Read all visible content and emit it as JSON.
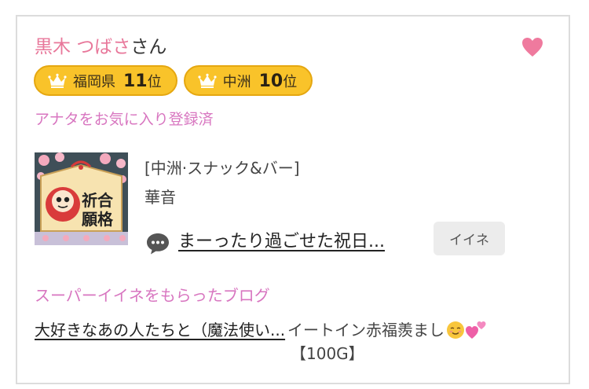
{
  "profile": {
    "name": "黒木 つばさ",
    "honorific": "さん",
    "favorite_icon": "heart-icon"
  },
  "rankings": [
    {
      "area": "福岡県",
      "rank": "11",
      "suffix": "位",
      "icon": "crown-icon"
    },
    {
      "area": "中洲",
      "rank": "10",
      "suffix": "位",
      "icon": "crown-icon"
    }
  ],
  "favorite_status": "アナタをお気に入り登録済",
  "shop": {
    "category": "[中洲·スナック&バー]",
    "name": "華音",
    "thumbnail_text": "祈願合格"
  },
  "latest_blog": {
    "icon": "speech-bubble-icon",
    "title": "まーったり過ごせた祝日...",
    "like_label": "イイネ"
  },
  "super_iine": {
    "heading": "スーパーイイネをもらったブログ",
    "blog_title": "大好きなあの人たちと（魔法使い...",
    "sender_text": "イートイン赤福羨まし",
    "amount": "【100G】"
  },
  "colors": {
    "accent_pink": "#e8779a",
    "label_pink": "#d876c0",
    "badge_gold": "#f9c32a"
  }
}
